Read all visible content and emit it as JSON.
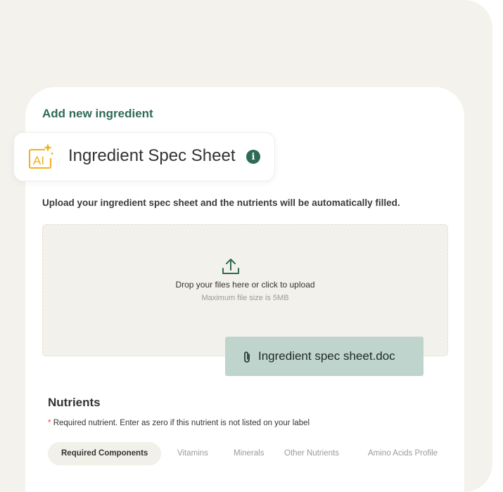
{
  "colors": {
    "accent": "#2f6b54",
    "ai_icon": "#f2b01e",
    "chip_bg": "#bfd4cc",
    "page_bg": "#f3f2ed",
    "required_asterisk": "#e04a3a"
  },
  "form": {
    "heading": "Add new ingredient"
  },
  "spec_sheet": {
    "title": "Ingredient Spec Sheet",
    "ai_icon_label": "AI",
    "ai_icon": "ai-sparkle-icon",
    "info_icon": "info-icon",
    "info_glyph": "i",
    "description": "Upload your ingredient spec sheet and the nutrients will be automatically filled."
  },
  "upload": {
    "icon": "upload-icon",
    "prompt": "Drop your files here or click to upload",
    "max_size": "Maximum file size is 5MB"
  },
  "attached_file": {
    "icon": "paperclip-icon",
    "name": "Ingredient spec sheet.doc"
  },
  "nutrients": {
    "title": "Nutrients",
    "required_asterisk": "*",
    "required_note": "Required nutrient. Enter as zero if this nutrient is not listed on your label",
    "tabs": [
      {
        "label": "Required Components",
        "active": true
      },
      {
        "label": "Vitamins",
        "active": false
      },
      {
        "label": "Minerals",
        "active": false
      },
      {
        "label": "Other Nutrients",
        "active": false
      },
      {
        "label": "Amino Acids Profile",
        "active": false
      }
    ]
  }
}
